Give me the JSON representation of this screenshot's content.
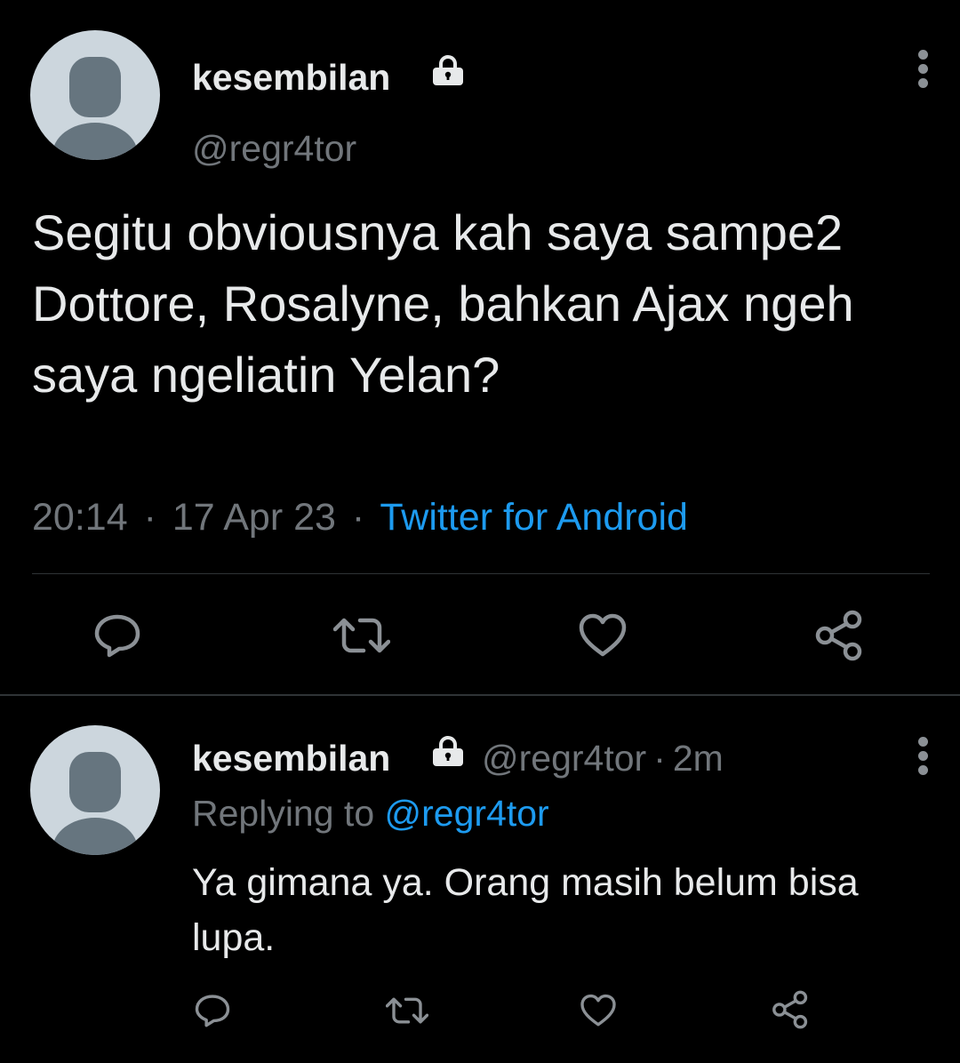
{
  "main_tweet": {
    "display_name": "kesembilan",
    "handle": "@regr4tor",
    "text": "Segitu obviousnya kah saya sampe2 Dottore, Rosalyne, bahkan Ajax ngeh saya ngeliatin Yelan?",
    "time": "20:14",
    "date": "17 Apr 23",
    "source": "Twitter for Android",
    "separator": "·"
  },
  "reply_tweet": {
    "display_name": "kesembilan",
    "handle": "@regr4tor",
    "age": "2m",
    "separator": "·",
    "replying_prefix": "Replying to",
    "replying_handle": "@regr4tor",
    "text": "Ya gimana ya. Orang masih belum bisa lupa."
  },
  "icons": {
    "protected": "lock-icon",
    "more": "more-vertical-icon",
    "reply": "reply-icon",
    "retweet": "retweet-icon",
    "like": "heart-icon",
    "share": "share-icon"
  },
  "colors": {
    "background": "#000000",
    "text": "#e7e9ea",
    "secondary": "#71767b",
    "link": "#1d9bf0",
    "divider": "#2f3336",
    "avatar_bg": "#ccd6dd",
    "avatar_fg": "#66757f"
  }
}
